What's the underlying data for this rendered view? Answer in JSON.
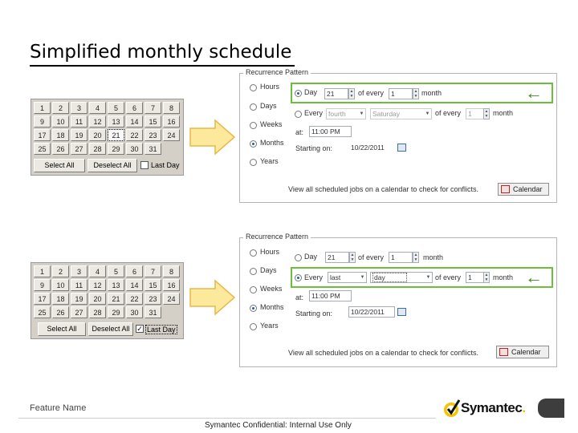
{
  "slide": {
    "title": "Simplified monthly schedule",
    "footer_feature": "Feature Name",
    "footer_confidential": "Symantec Confidential:  Internal Use Only",
    "logo_text": "Symantec",
    "logo_mark": "."
  },
  "colors": {
    "highlight": "#6bbf3a",
    "arrow_fill": "#fde99b",
    "arrow_stroke": "#e8b84a",
    "green_arrow": "#3b8a1e"
  },
  "grid_top": {
    "rows": [
      [
        "1",
        "2",
        "3",
        "4",
        "5",
        "6",
        "7",
        "8"
      ],
      [
        "9",
        "10",
        "11",
        "12",
        "13",
        "14",
        "15",
        "16"
      ],
      [
        "17",
        "18",
        "19",
        "20",
        "21",
        "22",
        "23",
        "24"
      ],
      [
        "25",
        "26",
        "27",
        "28",
        "29",
        "30",
        "31"
      ]
    ],
    "selected_day": "21",
    "select_all": "Select All",
    "deselect_all": "Deselect All",
    "last_day": "Last Day",
    "last_day_checked": false
  },
  "grid_bottom": {
    "rows": [
      [
        "1",
        "2",
        "3",
        "4",
        "5",
        "6",
        "7",
        "8"
      ],
      [
        "9",
        "10",
        "11",
        "12",
        "13",
        "14",
        "15",
        "16"
      ],
      [
        "17",
        "18",
        "19",
        "20",
        "21",
        "22",
        "23",
        "24"
      ],
      [
        "25",
        "26",
        "27",
        "28",
        "29",
        "30",
        "31"
      ]
    ],
    "select_all": "Select All",
    "deselect_all": "Deselect All",
    "last_day": "Last Day",
    "last_day_checked": true,
    "last_day_mark": "✓"
  },
  "panel_top": {
    "legend": "Recurrence Pattern",
    "options": [
      "Hours",
      "Days",
      "Weeks",
      "Months",
      "Years"
    ],
    "selected": "Months",
    "row1": {
      "label": "Day",
      "value": "21",
      "of_every": "of every",
      "count": "1",
      "unit": "month"
    },
    "row2": {
      "label": "Every",
      "ordinal": "fourth",
      "weekday": "Saturday",
      "of_every": "of every",
      "count": "1",
      "unit": "month"
    },
    "at_label": "at:",
    "at_value": "11:00 PM",
    "start_label": "Starting on:",
    "start_value": "10/22/2011",
    "view_all": "View all scheduled jobs on a calendar to check for conflicts.",
    "calendar_button": "Calendar",
    "arrow": "←"
  },
  "panel_bottom": {
    "legend": "Recurrence Pattern",
    "options": [
      "Hours",
      "Days",
      "Weeks",
      "Months",
      "Years"
    ],
    "selected": "Months",
    "row1": {
      "label": "Day",
      "value": "21",
      "of_every": "of every",
      "count": "1",
      "unit": "month"
    },
    "row2": {
      "label": "Every",
      "ordinal": "last",
      "weekday": "day",
      "of_every": "of every",
      "count": "1",
      "unit": "month"
    },
    "at_label": "at:",
    "at_value": "11:00 PM",
    "start_label": "Starting on:",
    "start_value": "10/22/2011",
    "view_all": "View all scheduled jobs on a calendar to check for conflicts.",
    "calendar_button": "Calendar",
    "arrow": "←"
  },
  "icons": {
    "dropdown": "▼",
    "spin_up": "▲",
    "spin_down": "▼"
  }
}
